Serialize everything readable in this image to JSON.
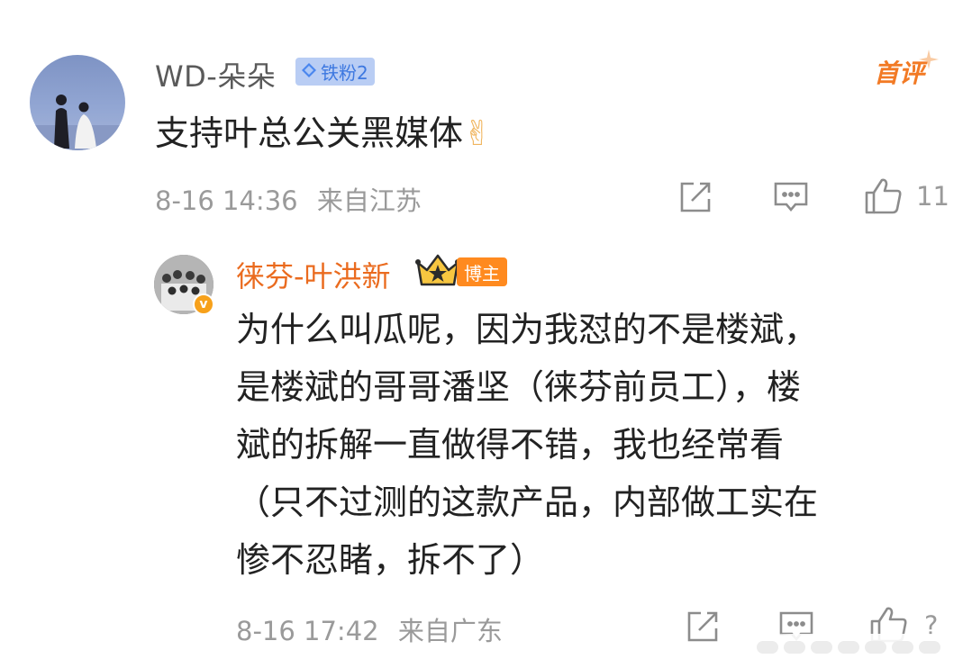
{
  "comment": {
    "username": "WD-朵朵",
    "fan_badge": {
      "icon": "diamond-icon",
      "label": "铁粉2"
    },
    "first_comment_tag": "首评",
    "content": "支持叶总公关黑媒体",
    "emoji": "✌",
    "timestamp": "8-16 14:36",
    "location": "来自江苏",
    "likes": "11"
  },
  "reply": {
    "username": "徕芬-叶洪新",
    "verified_icon": "v",
    "host_badge": "博主",
    "content_lines": [
      "为什么叫瓜呢，因为我怼的不是楼斌，",
      "是楼斌的哥哥潘坚（徕芬前员工），楼",
      "斌的拆解一直做得不错，我也经常看",
      "（只不过测的这款产品，内部做工实在",
      "惨不忍睹，拆不了）"
    ],
    "timestamp": "8-16 17:42",
    "location": "来自广东",
    "likes": "?"
  },
  "colors": {
    "name_gray": "#5a5a5a",
    "host_orange": "#ea6b1f",
    "first_tag_orange": "#f27a25",
    "fan_badge_bg": "#b9cdf4",
    "fan_badge_text": "#3d78e0",
    "meta_gray": "#9a9a9a",
    "icon_gray": "#8c8c8c"
  }
}
